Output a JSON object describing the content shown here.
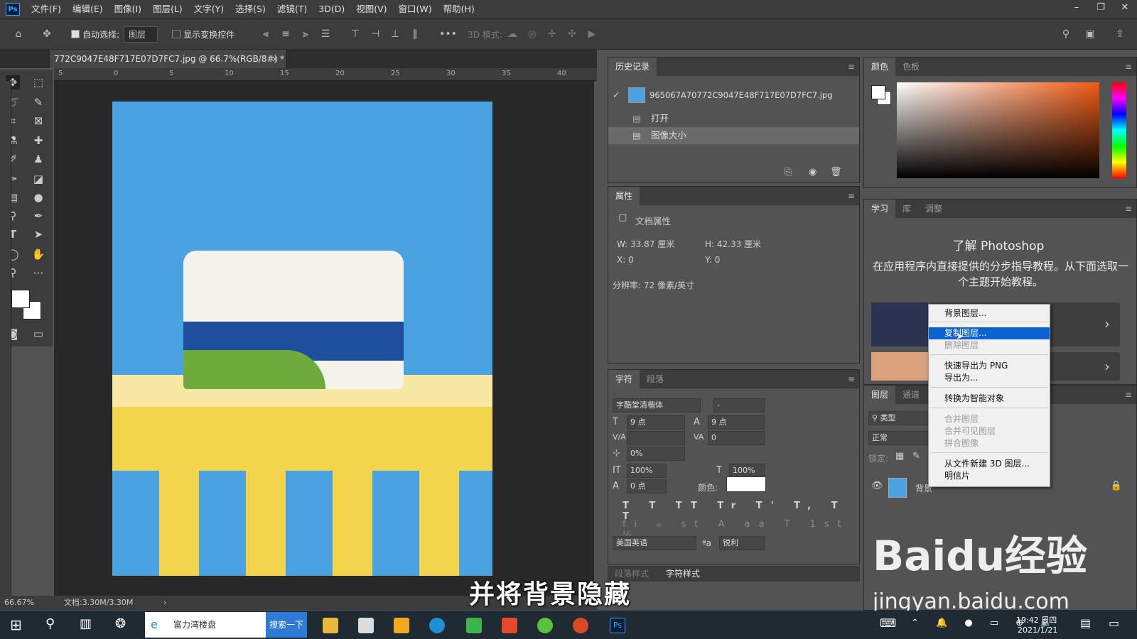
{
  "app": {
    "logo": "Ps",
    "menu": [
      "文件(F)",
      "编辑(E)",
      "图像(I)",
      "图层(L)",
      "文字(Y)",
      "选择(S)",
      "滤镜(T)",
      "3D(D)",
      "视图(V)",
      "窗口(W)",
      "帮助(H)"
    ]
  },
  "options": {
    "auto_select_label": "自动选择:",
    "auto_select_value": "图层",
    "show_transform_label": "显示变换控件",
    "mode_3d": "3D 模式:"
  },
  "document": {
    "tab_title": "772C9047E48F717E07D7FC7.jpg @ 66.7%(RGB/8#) *",
    "close": "×",
    "ruler_ticks": [
      "5",
      "0",
      "5",
      "10",
      "15",
      "20",
      "25",
      "30",
      "35",
      "40"
    ]
  },
  "status": {
    "zoom": "66.67%",
    "doc_size": "文档:3.30M/3.30M",
    "arrow": "›"
  },
  "history": {
    "tab": "历史记录",
    "snapshot": "965067A70772C9047E48F717E07D7FC7.jpg",
    "items": [
      "打开",
      "图像大小"
    ]
  },
  "properties": {
    "tab": "属性",
    "section": "文档属性",
    "w": "W: 33.87 厘米",
    "h": "H: 42.33 厘米",
    "x": "X: 0",
    "y": "Y: 0",
    "resolution": "分辨率: 72 像素/英寸"
  },
  "character": {
    "tabs": [
      "字符",
      "段落"
    ],
    "font": "字酷堂清楷体",
    "style": "-",
    "size": "9 点",
    "leading": "9 点",
    "tracking": "0",
    "scale_pct": "0%",
    "vscale": "100%",
    "hscale": "100%",
    "baseline": "0 点",
    "color_label": "颜色:",
    "language": "美国英语",
    "aa_label": "ªa",
    "aa": "锐利",
    "bottom_tabs": [
      "段落样式",
      "字符样式"
    ]
  },
  "color": {
    "tabs": [
      "颜色",
      "色板"
    ]
  },
  "learn": {
    "tabs": [
      "学习",
      "库",
      "调整"
    ],
    "title": "了解 Photoshop",
    "desc": "在应用程序内直接提供的分步指导教程。从下面选取一个主题开始教程。"
  },
  "layers": {
    "tabs": [
      "图层",
      "通道"
    ],
    "kind": "类型",
    "blend": "正常",
    "lock_label": "锁定:",
    "layer_name": "背景"
  },
  "context_menu": {
    "items": [
      "背景图层...",
      "复制图层...",
      "删除图层",
      "快速导出为 PNG",
      "导出为...",
      "转换为智能对象",
      "合并图层",
      "合并可见图层",
      "拼合图像",
      "从文件新建 3D 图层...",
      "明信片"
    ]
  },
  "taskbar": {
    "search_text": "富力湾楼盘",
    "search_btn": "搜索一下",
    "time": "19:42 周四",
    "date": "2021/1/21"
  },
  "overlay": {
    "subtitle": "并将背景隐藏",
    "watermark": "Baidu经验",
    "watermark_url": "jingyan.baidu.com"
  }
}
